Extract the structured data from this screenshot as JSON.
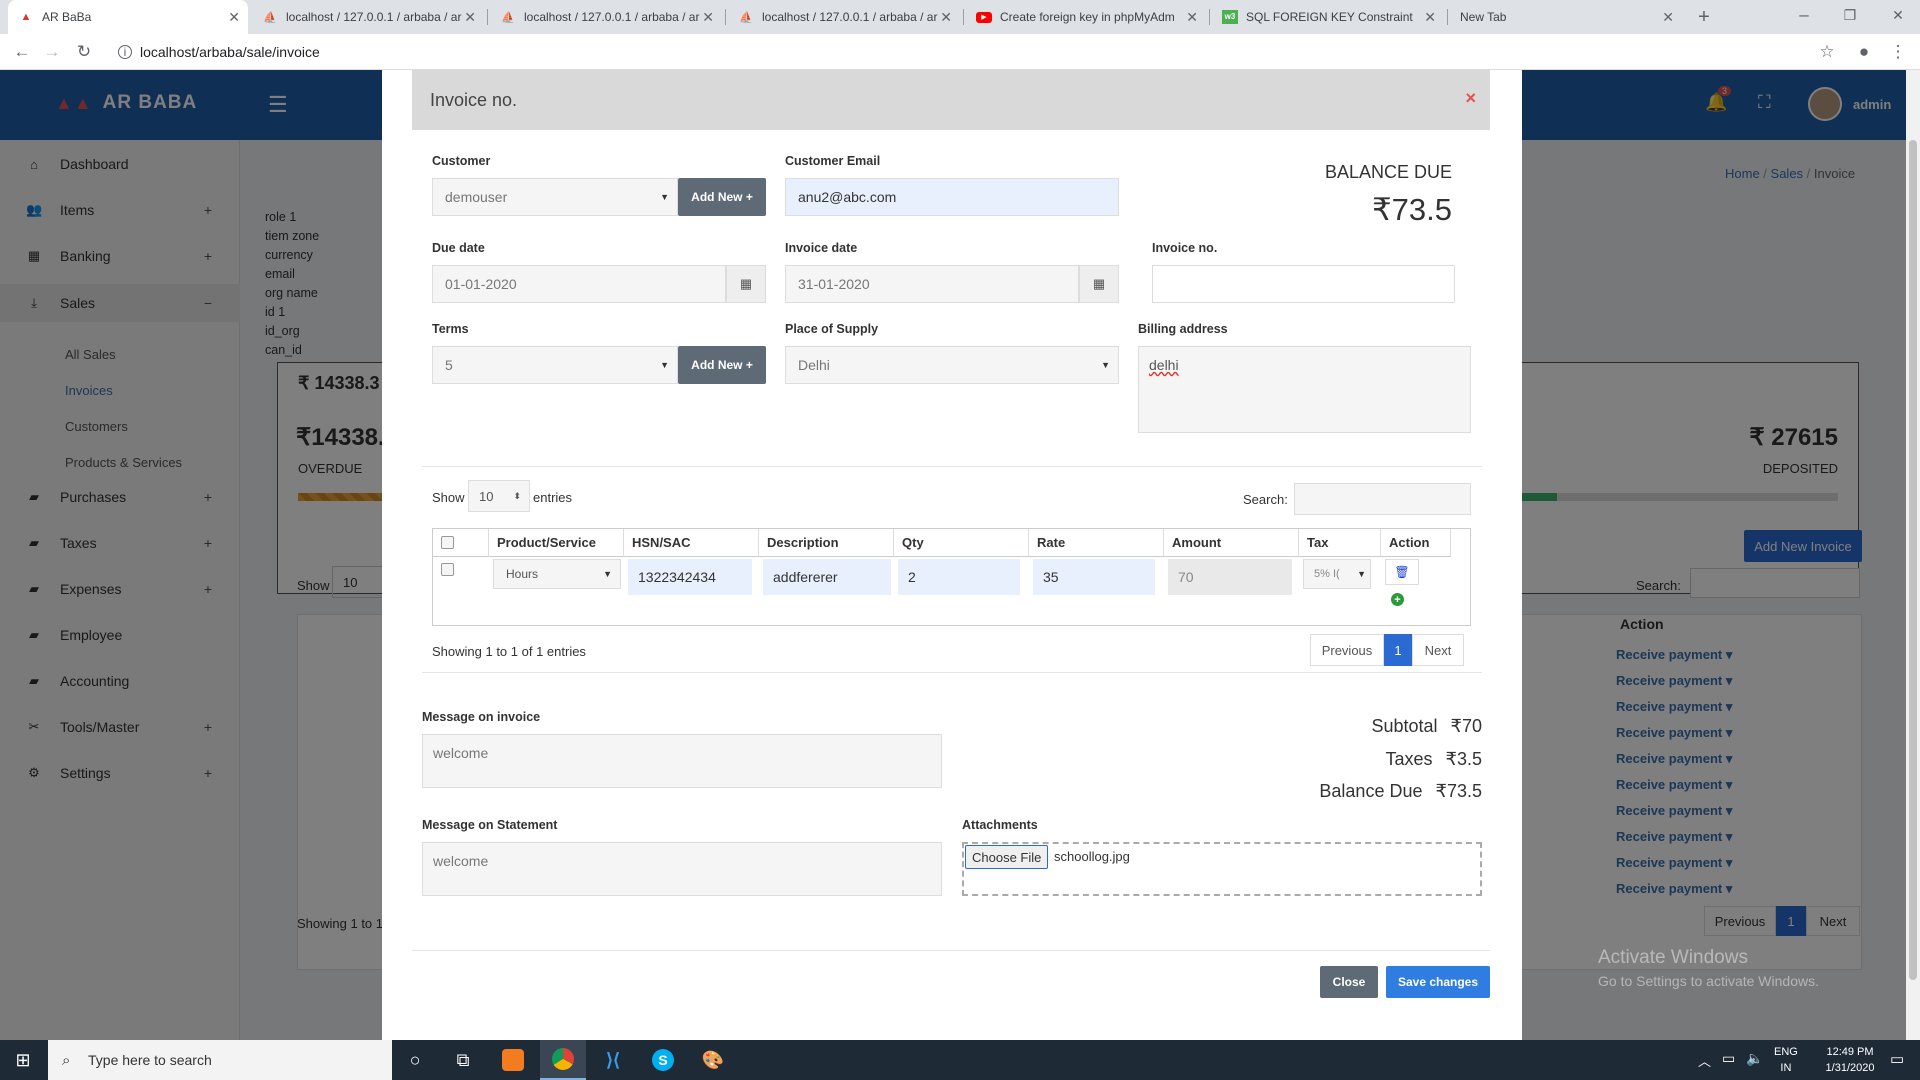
{
  "browser": {
    "tabs": [
      {
        "label": "AR BaBa",
        "icon": "arbaba-icon",
        "active": true
      },
      {
        "label": "localhost / 127.0.0.1 / arbaba / ar",
        "icon": "phpmyadmin-icon"
      },
      {
        "label": "localhost / 127.0.0.1 / arbaba / ar",
        "icon": "phpmyadmin-icon"
      },
      {
        "label": "localhost / 127.0.0.1 / arbaba / ar",
        "icon": "phpmyadmin-icon"
      },
      {
        "label": "Create foreign key in phpMyAdm",
        "icon": "youtube-icon"
      },
      {
        "label": "SQL FOREIGN KEY Constraint",
        "icon": "w3schools-icon"
      },
      {
        "label": "New Tab",
        "icon": "none"
      }
    ],
    "url": "localhost/arbaba/sale/invoice"
  },
  "app": {
    "logo_text": "AR BABA",
    "notification_count": "3",
    "user": "admin",
    "breadcrumb": [
      "Home",
      "Sales",
      "Invoice"
    ],
    "sidebar": [
      {
        "label": "Dashboard",
        "icon": "home-icon",
        "plus": ""
      },
      {
        "label": "Items",
        "icon": "users-icon",
        "plus": "+"
      },
      {
        "label": "Banking",
        "icon": "bank-icon",
        "plus": "+"
      },
      {
        "label": "Sales",
        "icon": "sales-icon",
        "plus": "−"
      },
      {
        "label": "Purchases",
        "icon": "briefcase-icon",
        "plus": "+"
      },
      {
        "label": "Taxes",
        "icon": "briefcase-icon",
        "plus": "+"
      },
      {
        "label": "Expenses",
        "icon": "briefcase-icon",
        "plus": "+"
      },
      {
        "label": "Employee",
        "icon": "briefcase-icon",
        "plus": ""
      },
      {
        "label": "Accounting",
        "icon": "briefcase-icon",
        "plus": ""
      },
      {
        "label": "Tools/Master",
        "icon": "tools-icon",
        "plus": "+"
      },
      {
        "label": "Settings",
        "icon": "settings-icon",
        "plus": "+"
      }
    ],
    "sales_sub": [
      "All Sales",
      "Invoices",
      "Customers",
      "Products & Services"
    ],
    "debug_text": [
      "role 1",
      "tiem zone",
      "currency",
      "email",
      "org name",
      "id 1",
      "id_org",
      "can_id"
    ],
    "overdue_amount_small": "14338.3",
    "overdue_amount": "₹14338.",
    "overdue_label": "OVERDUE",
    "deposited_amount": "₹ 27615",
    "deposited_label": "DEPOSITED",
    "add_new_invoice": "Add New Invoice",
    "bg_show": "Show",
    "bg_show_value": "10",
    "bg_search": "Search:",
    "bg_action_header": "Action",
    "receive_payment": "Receive payment",
    "bg_showing": "Showing 1 to 1",
    "bg_previous": "Previous",
    "bg_page": "1",
    "bg_next": "Next",
    "activate_title": "Activate Windows",
    "activate_sub": "Go to Settings to activate Windows."
  },
  "modal": {
    "title": "Invoice no.",
    "close_x": "×",
    "customer_label": "Customer",
    "customer_value": "demouser",
    "add_new": "Add New +",
    "email_label": "Customer Email",
    "email_value": "anu2@abc.com",
    "balance_due_label": "BALANCE DUE",
    "balance_due_value": "₹73.5",
    "due_date_label": "Due date",
    "due_date_value": "01-01-2020",
    "invoice_date_label": "Invoice date",
    "invoice_date_value": "31-01-2020",
    "invoice_no_label": "Invoice no.",
    "invoice_no_value": "",
    "terms_label": "Terms",
    "terms_value": "5",
    "place_label": "Place of Supply",
    "place_value": "Delhi",
    "billing_label": "Billing address",
    "billing_value": "delhi",
    "show_label": "Show",
    "show_value": "10",
    "entries_label": "entries",
    "search_label": "Search:",
    "table_headers": [
      "Product/Service",
      "HSN/SAC",
      "Description",
      "Qty",
      "Rate",
      "Amount",
      "Tax",
      "Action"
    ],
    "row": {
      "product": "Hours",
      "hsn": "1322342434",
      "description": "addfererer",
      "qty": "2",
      "rate": "35",
      "amount": "70",
      "tax": "5% I("
    },
    "showing_text": "Showing 1 to 1 of 1 entries",
    "previous": "Previous",
    "page": "1",
    "next": "Next",
    "message_invoice_label": "Message on invoice",
    "message_invoice_value": "welcome",
    "message_statement_label": "Message on Statement",
    "message_statement_value": "welcome",
    "subtotal_label": "Subtotal",
    "subtotal_value": "₹70",
    "taxes_label": "Taxes",
    "taxes_value": "₹3.5",
    "balance_label": "Balance Due",
    "balance_value": "₹73.5",
    "attachments_label": "Attachments",
    "choose_file": "Choose File",
    "file_name": "schoollog.jpg",
    "close_btn": "Close",
    "save_btn": "Save changes"
  },
  "taskbar": {
    "search_placeholder": "Type here to search",
    "lang": "ENG",
    "region": "IN",
    "time": "12:49 PM",
    "date": "1/31/2020"
  },
  "colors": {
    "primary": "#1e5fa8",
    "save": "#2f7de1",
    "close": "#5e6a75",
    "danger": "#e05252"
  }
}
